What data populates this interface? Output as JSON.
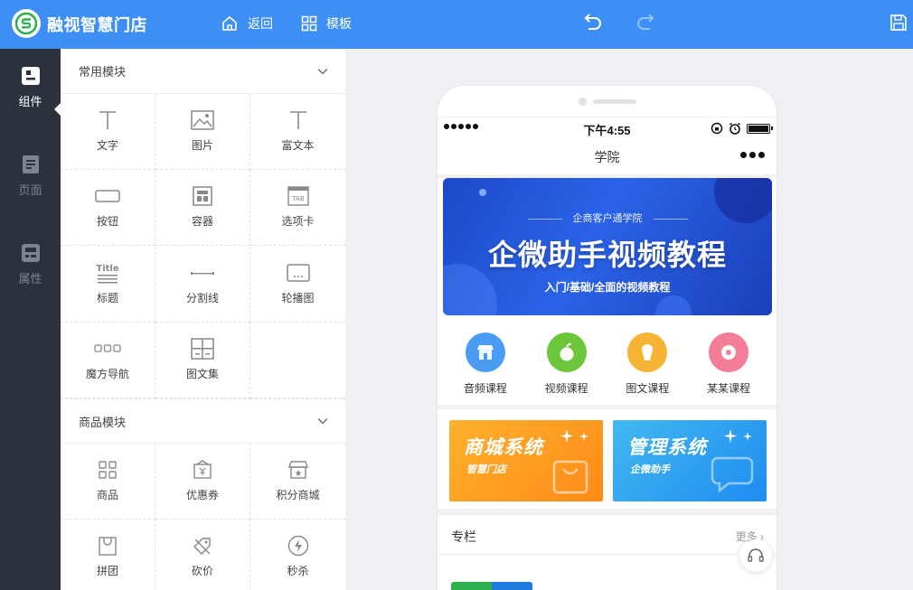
{
  "header": {
    "app_title": "融视智慧门店",
    "back_label": "返回",
    "template_label": "模板"
  },
  "rail": {
    "items": [
      {
        "label": "组件"
      },
      {
        "label": "页面"
      },
      {
        "label": "属性"
      }
    ]
  },
  "panel": {
    "common_title": "常用模块",
    "common_items": [
      {
        "label": "文字"
      },
      {
        "label": "图片"
      },
      {
        "label": "富文本"
      },
      {
        "label": "按钮"
      },
      {
        "label": "容器"
      },
      {
        "label": "选项卡"
      },
      {
        "label": "标题"
      },
      {
        "label": "分割线"
      },
      {
        "label": "轮播图"
      },
      {
        "label": "魔方导航"
      },
      {
        "label": "图文集"
      }
    ],
    "icon_text": {
      "tab": "TAB",
      "title": "Title"
    },
    "goods_title": "商品模块",
    "goods_items": [
      {
        "label": "商品"
      },
      {
        "label": "优惠券"
      },
      {
        "label": "积分商城"
      },
      {
        "label": "拼团"
      },
      {
        "label": "砍价"
      },
      {
        "label": "秒杀"
      }
    ]
  },
  "phone": {
    "status_time": "下午4:55",
    "nav_title": "学院",
    "banner": {
      "subtitle": "企商客户通学院",
      "title": "企微助手视频教程",
      "desc": "入门/基础/全面的视频教程"
    },
    "categories": [
      {
        "label": "音频课程",
        "color": "#4a9cf2"
      },
      {
        "label": "视频课程",
        "color": "#6cc63a"
      },
      {
        "label": "图文课程",
        "color": "#f5b433"
      },
      {
        "label": "某某课程",
        "color": "#f47d98"
      }
    ],
    "promos": [
      {
        "title": "商城系统",
        "subtitle": "智慧门店"
      },
      {
        "title": "管理系统",
        "subtitle": "企微助手"
      }
    ],
    "column_title": "专栏",
    "column_more": "更多"
  },
  "colors": {
    "brand": "#3d8ef5",
    "rail_bg": "#2a323b"
  }
}
